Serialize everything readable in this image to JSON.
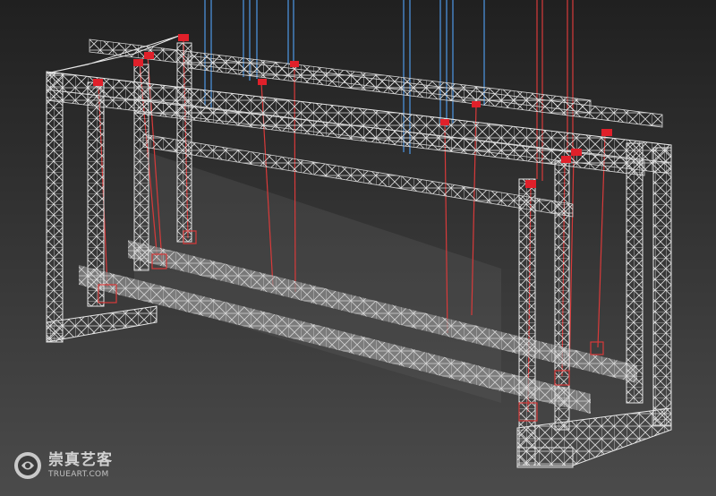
{
  "scene": {
    "description_kind": "3d-viewport-render",
    "colors": {
      "background_top": "#232323",
      "background_bottom": "#4a4a4a",
      "truss": "#e8e8e8",
      "truss_shadow": "#8a8a8a",
      "beam_fill": "#9a9a9a",
      "cable_blue": "#4a8fd8",
      "cable_red": "#d83a3a",
      "marker_red": "#e0202a"
    },
    "icons": [
      "rigging-marker-icon"
    ]
  },
  "watermark": {
    "brand_cn": "崇真艺客",
    "brand_en": "TRUEART.COM",
    "logo_icon": "trueart-logo-icon"
  }
}
